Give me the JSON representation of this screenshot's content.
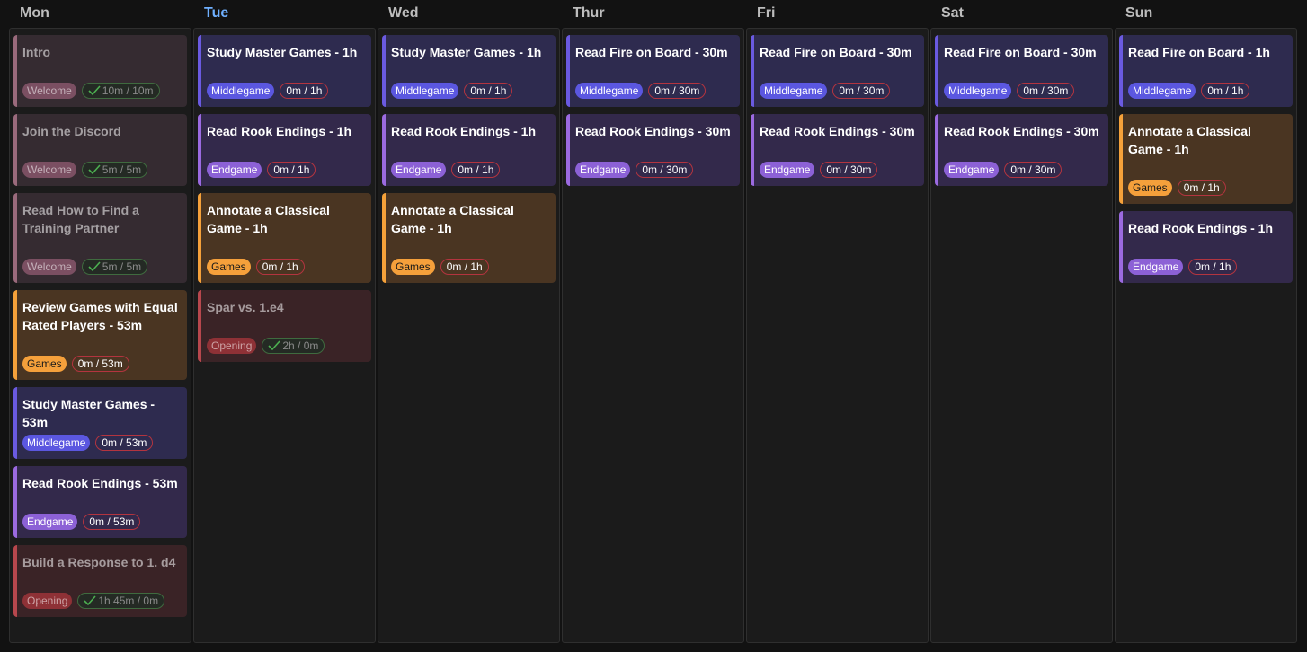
{
  "days": [
    {
      "name": "Mon",
      "today": false,
      "tasks": [
        {
          "title": "Intro",
          "tag": "Welcome",
          "time": "10m / 10m",
          "done": true
        },
        {
          "title": "Join the Discord",
          "tag": "Welcome",
          "time": "5m / 5m",
          "done": true
        },
        {
          "title": "Read How to Find a Training Partner",
          "tag": "Welcome",
          "time": "5m / 5m",
          "done": true
        },
        {
          "title": "Review Games with Equal Rated Players - 53m",
          "tag": "Games",
          "time": "0m / 53m",
          "done": false
        },
        {
          "title": "Study Master Games - 53m",
          "tag": "Middlegame",
          "time": "0m / 53m",
          "done": false
        },
        {
          "title": "Read Rook Endings - 53m",
          "tag": "Endgame",
          "time": "0m / 53m",
          "done": false
        },
        {
          "title": "Build a Response to 1. d4",
          "tag": "Opening",
          "time": "1h 45m / 0m",
          "done": true
        }
      ]
    },
    {
      "name": "Tue",
      "today": true,
      "tasks": [
        {
          "title": "Study Master Games - 1h",
          "tag": "Middlegame",
          "time": "0m / 1h",
          "done": false
        },
        {
          "title": "Read Rook Endings - 1h",
          "tag": "Endgame",
          "time": "0m / 1h",
          "done": false
        },
        {
          "title": "Annotate a Classical Game - 1h",
          "tag": "Games",
          "time": "0m / 1h",
          "done": false
        },
        {
          "title": "Spar vs. 1.e4",
          "tag": "Opening",
          "time": "2h / 0m",
          "done": true
        }
      ]
    },
    {
      "name": "Wed",
      "today": false,
      "tasks": [
        {
          "title": "Study Master Games - 1h",
          "tag": "Middlegame",
          "time": "0m / 1h",
          "done": false
        },
        {
          "title": "Read Rook Endings - 1h",
          "tag": "Endgame",
          "time": "0m / 1h",
          "done": false
        },
        {
          "title": "Annotate a Classical Game - 1h",
          "tag": "Games",
          "time": "0m / 1h",
          "done": false
        }
      ]
    },
    {
      "name": "Thur",
      "today": false,
      "tasks": [
        {
          "title": "Read Fire on Board - 30m",
          "tag": "Middlegame",
          "time": "0m / 30m",
          "done": false
        },
        {
          "title": "Read Rook Endings - 30m",
          "tag": "Endgame",
          "time": "0m / 30m",
          "done": false
        }
      ]
    },
    {
      "name": "Fri",
      "today": false,
      "tasks": [
        {
          "title": "Read Fire on Board - 30m",
          "tag": "Middlegame",
          "time": "0m / 30m",
          "done": false
        },
        {
          "title": "Read Rook Endings - 30m",
          "tag": "Endgame",
          "time": "0m / 30m",
          "done": false
        }
      ]
    },
    {
      "name": "Sat",
      "today": false,
      "tasks": [
        {
          "title": "Read Fire on Board - 30m",
          "tag": "Middlegame",
          "time": "0m / 30m",
          "done": false
        },
        {
          "title": "Read Rook Endings - 30m",
          "tag": "Endgame",
          "time": "0m / 30m",
          "done": false
        }
      ]
    },
    {
      "name": "Sun",
      "today": false,
      "tasks": [
        {
          "title": "Read Fire on Board - 1h",
          "tag": "Middlegame",
          "time": "0m / 1h",
          "done": false
        },
        {
          "title": "Annotate a Classical Game - 1h",
          "tag": "Games",
          "time": "0m / 1h",
          "done": false
        },
        {
          "title": "Read Rook Endings - 1h",
          "tag": "Endgame",
          "time": "0m / 1h",
          "done": false
        }
      ]
    }
  ],
  "icons": {
    "done": "check-icon"
  },
  "colors": {
    "today_header": "#6fb0ff",
    "middlegame": "#5b57e0",
    "endgame": "#8c61d6",
    "games": "#f5a03b",
    "welcome": "#7b4f62",
    "opening": "#8e3136"
  }
}
